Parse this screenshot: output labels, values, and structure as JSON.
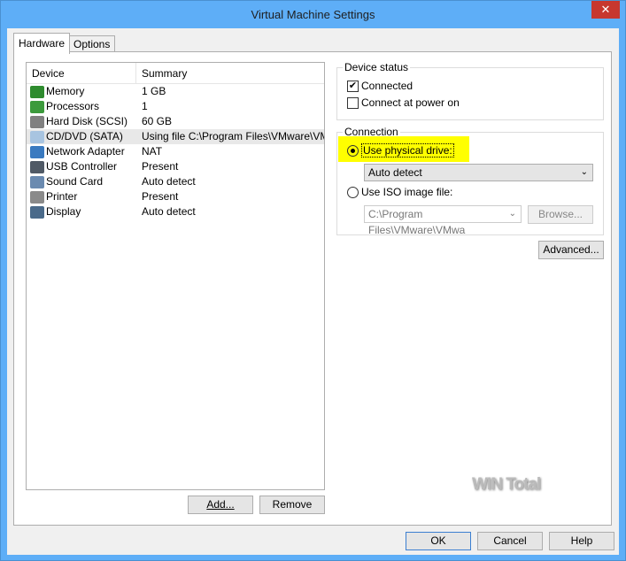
{
  "window": {
    "title": "Virtual Machine Settings",
    "close": "✕"
  },
  "tabs": [
    {
      "label": "Hardware"
    },
    {
      "label": "Options"
    }
  ],
  "devices": {
    "headers": [
      "Device",
      "Summary"
    ],
    "rows": [
      {
        "device": "Memory",
        "summary": "1 GB",
        "icon": "memory-icon",
        "color": "#2e8b2e"
      },
      {
        "device": "Processors",
        "summary": "1",
        "icon": "processor-icon",
        "color": "#3c9a3c"
      },
      {
        "device": "Hard Disk (SCSI)",
        "summary": "60 GB",
        "icon": "hard-disk-icon",
        "color": "#808080"
      },
      {
        "device": "CD/DVD (SATA)",
        "summary": "Using file C:\\Program Files\\VMware\\VM...",
        "icon": "cd-dvd-icon",
        "color": "#a8c4e0"
      },
      {
        "device": "Network Adapter",
        "summary": "NAT",
        "icon": "network-adapter-icon",
        "color": "#3a7ac0"
      },
      {
        "device": "USB Controller",
        "summary": "Present",
        "icon": "usb-icon",
        "color": "#505a66"
      },
      {
        "device": "Sound Card",
        "summary": "Auto detect",
        "icon": "sound-card-icon",
        "color": "#6a8ab0"
      },
      {
        "device": "Printer",
        "summary": "Present",
        "icon": "printer-icon",
        "color": "#8a8a8a"
      },
      {
        "device": "Display",
        "summary": "Auto detect",
        "icon": "display-icon",
        "color": "#4a6a8a"
      }
    ]
  },
  "add": "Add...",
  "remove": "Remove",
  "status": {
    "legend": "Device status",
    "connected": "Connected",
    "connect_power_on": "Connect at power on"
  },
  "connection": {
    "legend": "Connection",
    "physical": "Use physical drive:",
    "drive_value": "Auto detect",
    "iso": "Use ISO image file:",
    "iso_value": "C:\\Program Files\\VMware\\VMwa",
    "browse": "Browse..."
  },
  "advanced": "Advanced...",
  "footer": {
    "ok": "OK",
    "cancel": "Cancel",
    "help": "Help"
  },
  "watermark": "WIN Total",
  "highlight": "#ffff00"
}
